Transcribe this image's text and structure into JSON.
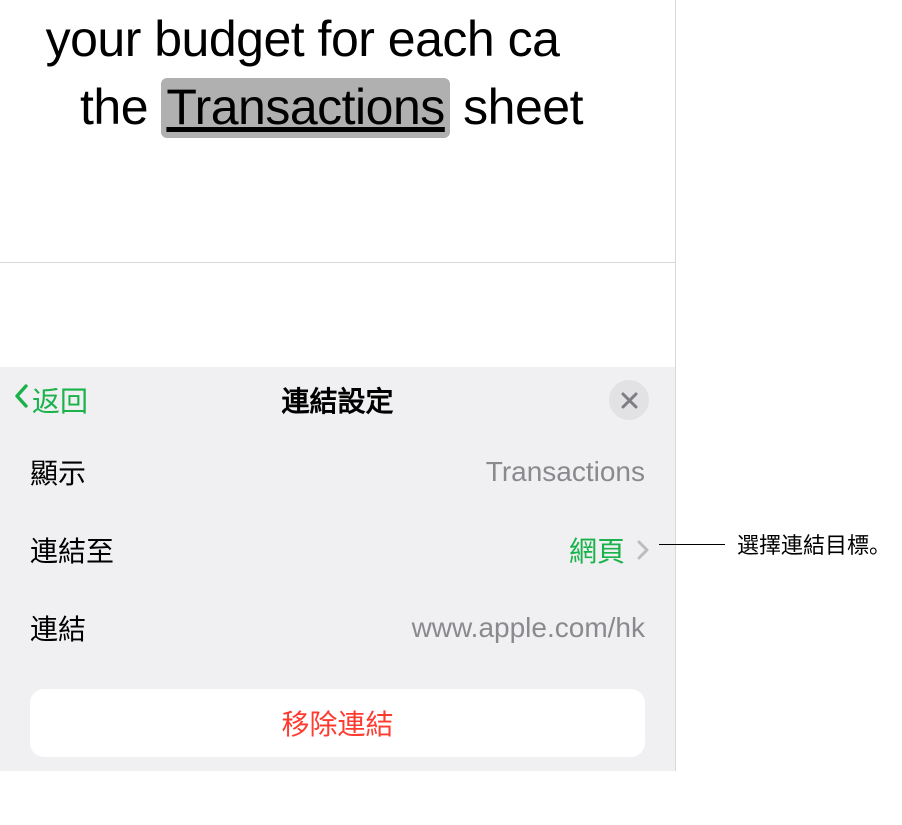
{
  "document": {
    "line1_prefix": "your budget for each ca",
    "line2_prefix": "the ",
    "highlighted_word": "Transactions",
    "line2_suffix": " sheet"
  },
  "panel": {
    "back_label": "返回",
    "title": "連結設定",
    "rows": {
      "display": {
        "label": "顯示",
        "value": "Transactions"
      },
      "linkto": {
        "label": "連結至",
        "value": "網頁"
      },
      "link": {
        "label": "連結",
        "value": "www.apple.com/hk"
      }
    },
    "remove_label": "移除連結"
  },
  "callout": {
    "text": "選擇連結目標。"
  }
}
